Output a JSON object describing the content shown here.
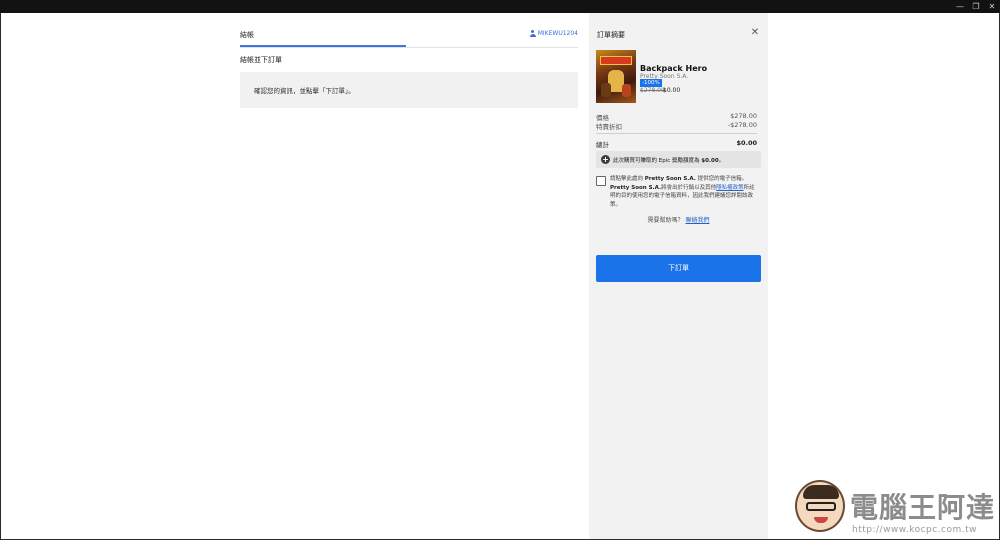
{
  "window": {
    "minimize_glyph": "—",
    "maximize_glyph": "❐",
    "close_glyph": "✕"
  },
  "checkout": {
    "tab_label": "結帳",
    "account_name": "MIKEWU1204",
    "section_heading": "結帳並下訂單",
    "info_message": "確認您的資訊，並點擊「下訂單」。"
  },
  "summary": {
    "title": "訂單摘要",
    "close_glyph": "✕",
    "game": {
      "title": "Backpack Hero",
      "publisher": "Pretty Soon S.A.",
      "discount_badge": "-100%",
      "original_price": "$278.00",
      "final_price": "$0.00"
    },
    "rows": {
      "price_label": "價格",
      "price_value": "$278.00",
      "discount_label": "特賣折扣",
      "discount_value": "-$278.00",
      "total_label": "總計",
      "total_value": "$0.00"
    },
    "reward": {
      "text_before": "此次購買可賺取的 Epic 獎勵額度為",
      "amount": "$0.00",
      "text_after": "。"
    },
    "consent": {
      "part1": "請點擊此處向",
      "publisher_1": "Pretty Soon S.A.",
      "part2": "提供您的電子信箱。",
      "publisher_2": "Pretty Soon S.A.",
      "part3": "將會出於行銷以及其他",
      "privacy_link": "隱私權政策",
      "part4": "所註明的目的使用您的電子信箱資料，因此我們建議您詳閱該政策。"
    },
    "help": {
      "question": "需要幫助嗎？",
      "link": "聯絡我們"
    },
    "place_order_label": "下訂單"
  },
  "watermark": {
    "title": "電腦王阿達",
    "url": "http://www.kocpc.com.tw"
  },
  "colors": {
    "accent": "#1a73e8",
    "panel_bg": "#f2f2f2",
    "link": "#2a62c8"
  }
}
